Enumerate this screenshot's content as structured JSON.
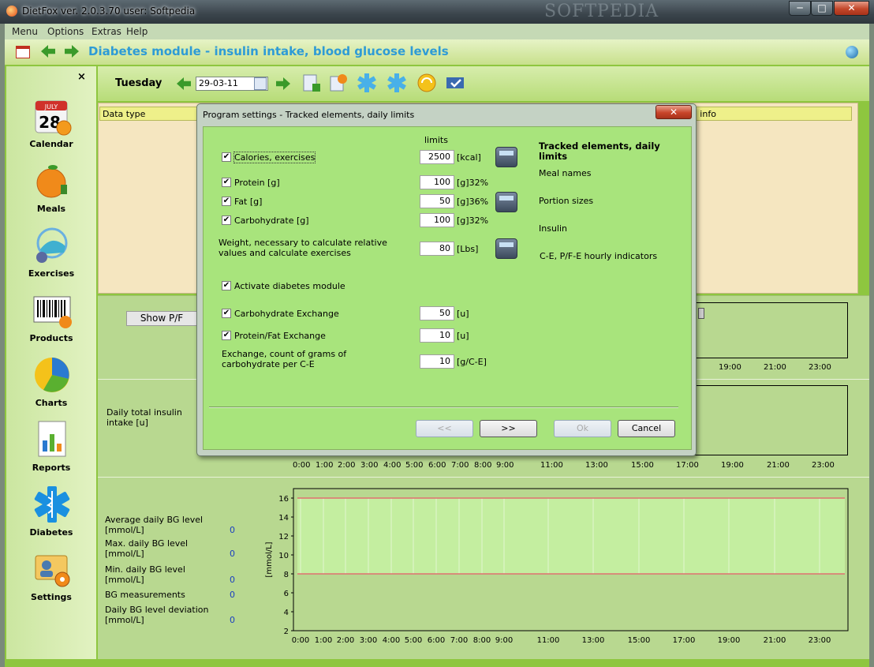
{
  "window": {
    "title": "DietFox  ver. 2.0.3.70 user: Softpedia",
    "watermark": "SOFTPEDIA",
    "minimize": "─",
    "maximize": "□",
    "close": "✕"
  },
  "menu": [
    "Menu",
    "Options",
    "Extras",
    "Help"
  ],
  "module_title": "Diabetes module - insulin intake, blood glucose levels",
  "sidebar": {
    "close": "×",
    "items": [
      {
        "label": "Calendar",
        "icon": "calendar-icon",
        "badge": "JULY",
        "number": "28"
      },
      {
        "label": "Meals",
        "icon": "orange-icon"
      },
      {
        "label": "Exercises",
        "icon": "exercise-icon"
      },
      {
        "label": "Products",
        "icon": "barcode-icon"
      },
      {
        "label": "Charts",
        "icon": "pie-chart-icon"
      },
      {
        "label": "Reports",
        "icon": "reports-icon"
      },
      {
        "label": "Diabetes",
        "icon": "medical-star-icon"
      },
      {
        "label": "Settings",
        "icon": "settings-icon"
      }
    ]
  },
  "day": {
    "name": "Tuesday",
    "date": "29-03-11"
  },
  "data_table": {
    "col_first": "Data type",
    "col_last": "al info"
  },
  "show_button": "Show P/F",
  "insulin_label": "Daily total insulin intake [u]",
  "hour_ticks_partial": [
    "19:00",
    "21:00",
    "23:00"
  ],
  "hour_ticks_full": [
    "0:00",
    "1:00",
    "2:00",
    "3:00",
    "4:00",
    "5:00",
    "6:00",
    "7:00",
    "8:00",
    "9:00",
    "11:00",
    "13:00",
    "15:00",
    "17:00",
    "19:00",
    "21:00",
    "23:00"
  ],
  "bg_stats": [
    {
      "label": "Average daily BG level [mmol/L]",
      "value": "0"
    },
    {
      "label": "Max. daily BG level [mmol/L]",
      "value": "0"
    },
    {
      "label": "Min. daily BG level [mmol/L]",
      "value": "0"
    },
    {
      "label": "BG measurements",
      "value": "0"
    },
    {
      "label": "Daily BG level deviation [mmol/L]",
      "value": "0"
    }
  ],
  "chart_data": {
    "type": "line",
    "ylabel": "[mmol/L]",
    "ylim": [
      2,
      17
    ],
    "yticks": [
      "2",
      "4",
      "6",
      "8",
      "10",
      "12",
      "14",
      "16"
    ],
    "x": [
      "0:00",
      "1:00",
      "2:00",
      "3:00",
      "4:00",
      "5:00",
      "6:00",
      "7:00",
      "8:00",
      "9:00",
      "11:00",
      "13:00",
      "15:00",
      "17:00",
      "19:00",
      "21:00",
      "23:00"
    ],
    "band": {
      "low": 8,
      "high": 16
    },
    "series": [],
    "grid": true
  },
  "dialog": {
    "title": "Program settings - Tracked elements, daily limits",
    "close": "✕",
    "limits_header": "limits",
    "rows": [
      {
        "label": "Calories, exercises",
        "checked": true,
        "value": "2500",
        "unit": "[kcal]"
      },
      {
        "label": "Protein [g]",
        "checked": true,
        "value": "100",
        "unit": "[g]32%"
      },
      {
        "label": "Fat [g]",
        "checked": true,
        "value": "50",
        "unit": "[g]36%"
      },
      {
        "label": "Carbohydrate [g]",
        "checked": true,
        "value": "100",
        "unit": "[g]32%"
      }
    ],
    "weight": {
      "label": "Weight, necessary to calculate relative values and calculate exercises",
      "value": "80",
      "unit": "[Lbs]"
    },
    "activate_diabetes": {
      "label": "Activate diabetes module",
      "checked": true
    },
    "carb_exchange": {
      "label": "Carbohydrate Exchange",
      "checked": true,
      "value": "50",
      "unit": "[u]"
    },
    "pf_exchange": {
      "label": "Protein/Fat Exchange",
      "checked": true,
      "value": "10",
      "unit": "[u]"
    },
    "exchange_grams": {
      "label": "Exchange, count of grams of carbohydrate per C-E",
      "value": "10",
      "unit": "[g/C-E]"
    },
    "nav": {
      "heading": "Tracked elements, daily limits",
      "items": [
        "Meal names",
        "Portion sizes",
        "Insulin",
        "C-E, P/F-E hourly indicators"
      ]
    },
    "buttons": {
      "prev": "<<",
      "next": ">>",
      "ok": "Ok",
      "cancel": "Cancel"
    }
  }
}
